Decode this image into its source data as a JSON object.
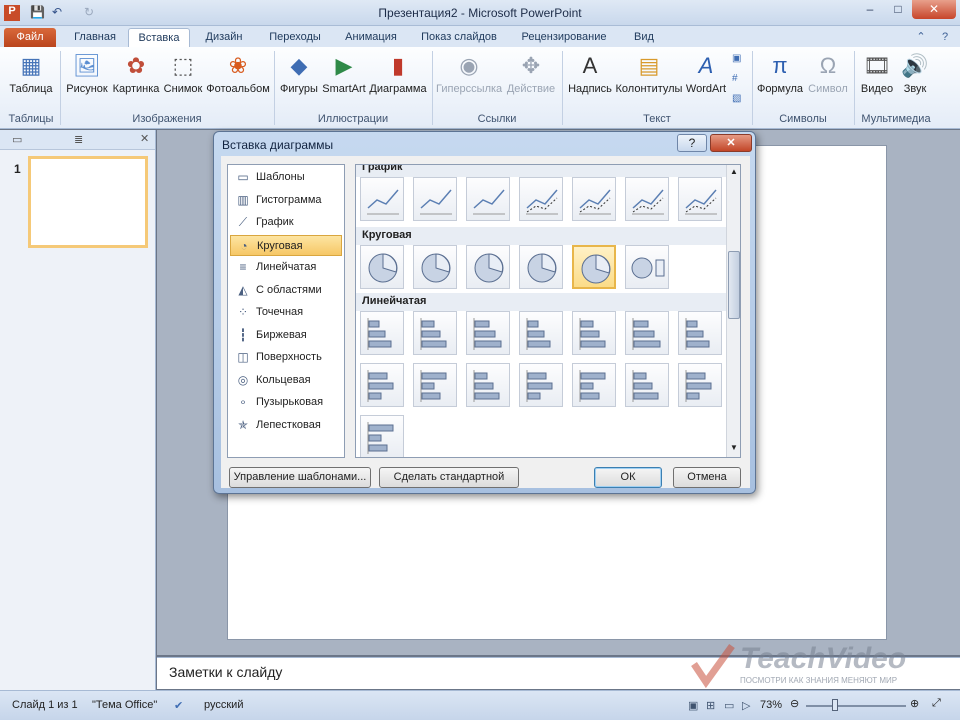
{
  "window": {
    "title": "Презентация2 - Microsoft PowerPoint",
    "min": "–",
    "max": "□",
    "close": "✕"
  },
  "tabs": [
    "Файл",
    "Главная",
    "Вставка",
    "Дизайн",
    "Переходы",
    "Анимация",
    "Показ слайдов",
    "Рецензирование",
    "Вид"
  ],
  "active_tab": "Вставка",
  "ribbon": {
    "buttons": [
      {
        "label": "Таблица",
        "icon": "table-icon",
        "disabled": false
      },
      {
        "label": "Рисунок",
        "icon": "picture-icon",
        "disabled": false
      },
      {
        "label": "Картинка",
        "icon": "clipart-icon",
        "disabled": false
      },
      {
        "label": "Снимок",
        "icon": "screenshot-icon",
        "disabled": false
      },
      {
        "label": "Фотоальбом",
        "icon": "photoalbum-icon",
        "disabled": false
      },
      {
        "label": "Фигуры",
        "icon": "shapes-icon",
        "disabled": false
      },
      {
        "label": "SmartArt",
        "icon": "smartart-icon",
        "disabled": false
      },
      {
        "label": "Диаграмма",
        "icon": "chart-icon",
        "disabled": false
      },
      {
        "label": "Гиперссылка",
        "icon": "hyperlink-icon",
        "disabled": true
      },
      {
        "label": "Действие",
        "icon": "action-icon",
        "disabled": true
      },
      {
        "label": "Надпись",
        "icon": "textbox-icon",
        "disabled": false
      },
      {
        "label": "Колонтитулы",
        "icon": "header-footer-icon",
        "disabled": false
      },
      {
        "label": "WordArt",
        "icon": "wordart-icon",
        "disabled": false
      },
      {
        "label": "Формула",
        "icon": "equation-icon",
        "disabled": false
      },
      {
        "label": "Символ",
        "icon": "symbol-icon",
        "disabled": true
      },
      {
        "label": "Видео",
        "icon": "video-icon",
        "disabled": false
      },
      {
        "label": "Звук",
        "icon": "audio-icon",
        "disabled": false
      }
    ],
    "groups": [
      "Таблицы",
      "Изображения",
      "Иллюстрации",
      "Ссылки",
      "Текст",
      "Символы",
      "Мультимедиа"
    ]
  },
  "slides_pane": {
    "slide_number": "1"
  },
  "notes_placeholder": "Заметки к слайду",
  "status": {
    "slide": "Слайд 1 из 1",
    "theme": "\"Тема Office\"",
    "language": "русский",
    "zoom": "73%"
  },
  "watermark": {
    "brand": "TeachVideo",
    "tagline": "ПОСМОТРИ КАК ЗНАНИЯ МЕНЯЮТ МИР"
  },
  "dialog": {
    "title": "Вставка диаграммы",
    "help": "?",
    "close": "✕",
    "categories": [
      {
        "label": "Шаблоны",
        "icon": "folder-icon"
      },
      {
        "label": "Гистограмма",
        "icon": "column-chart-icon"
      },
      {
        "label": "График",
        "icon": "line-chart-icon"
      },
      {
        "label": "Круговая",
        "icon": "pie-chart-icon"
      },
      {
        "label": "Линейчатая",
        "icon": "bar-chart-icon"
      },
      {
        "label": "С областями",
        "icon": "area-chart-icon"
      },
      {
        "label": "Точечная",
        "icon": "scatter-chart-icon"
      },
      {
        "label": "Биржевая",
        "icon": "stock-chart-icon"
      },
      {
        "label": "Поверхность",
        "icon": "surface-chart-icon"
      },
      {
        "label": "Кольцевая",
        "icon": "doughnut-chart-icon"
      },
      {
        "label": "Пузырьковая",
        "icon": "bubble-chart-icon"
      },
      {
        "label": "Лепестковая",
        "icon": "radar-chart-icon"
      }
    ],
    "selected_category": "Круговая",
    "gallery": {
      "sections": [
        {
          "title": "График",
          "count": 7,
          "kind": "line"
        },
        {
          "title": "Круговая",
          "count": 6,
          "kind": "pie"
        },
        {
          "title": "Линейчатая",
          "count": 15,
          "kind": "bar"
        }
      ],
      "selected": "pie-4"
    },
    "buttons": {
      "manage": "Управление шаблонами...",
      "default": "Сделать стандартной",
      "ok": "ОК",
      "cancel": "Отмена"
    }
  }
}
